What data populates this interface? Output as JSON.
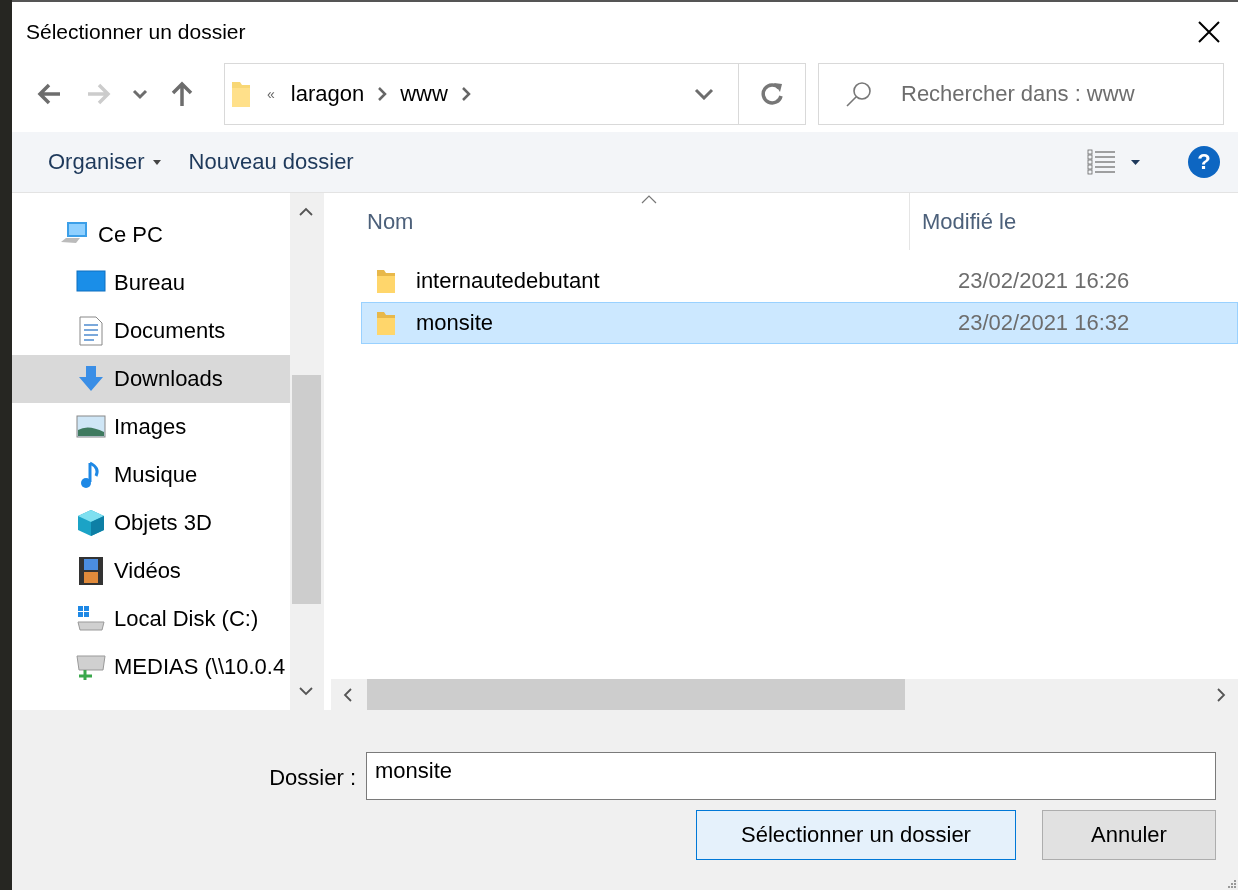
{
  "window": {
    "title": "Sélectionner un dossier"
  },
  "nav": [
    {
      "kind": "back",
      "disabled": false
    },
    {
      "kind": "forward",
      "disabled": true
    },
    {
      "kind": "recent",
      "disabled": false
    },
    {
      "kind": "up",
      "disabled": false
    }
  ],
  "address": {
    "overflow": "«",
    "segments": [
      "laragon",
      "www"
    ]
  },
  "search": {
    "placeholder": "Rechercher dans : www"
  },
  "toolbar": {
    "organize": "Organiser",
    "new_folder": "Nouveau dossier",
    "help": "?"
  },
  "sidebar": {
    "items": [
      {
        "label": "Ce PC",
        "kind": "pc",
        "selected": false,
        "children": [
          {
            "label": "Bureau",
            "kind": "desktop",
            "selected": false
          },
          {
            "label": "Documents",
            "kind": "documents",
            "selected": false
          },
          {
            "label": "Downloads",
            "kind": "downloads",
            "selected": true
          },
          {
            "label": "Images",
            "kind": "images",
            "selected": false
          },
          {
            "label": "Musique",
            "kind": "music",
            "selected": false
          },
          {
            "label": "Objets 3D",
            "kind": "objects3d",
            "selected": false
          },
          {
            "label": "Vidéos",
            "kind": "videos",
            "selected": false
          },
          {
            "label": "Local Disk (C:)",
            "kind": "disk",
            "selected": false
          },
          {
            "label": "MEDIAS (\\\\10.0.4",
            "kind": "netdrive",
            "selected": false
          }
        ]
      }
    ]
  },
  "table": {
    "columns": [
      "Nom",
      "Modifié le"
    ],
    "rows": [
      {
        "name": "internautedebutant",
        "modified": "23/02/2021 16:26",
        "selected": false
      },
      {
        "name": "monsite",
        "modified": "23/02/2021 16:32",
        "selected": true
      }
    ]
  },
  "folder_field": {
    "label": "Dossier :",
    "value": "monsite"
  },
  "buttons": [
    {
      "label": "Sélectionner un dossier",
      "kind": "primary"
    },
    {
      "label": "Annuler",
      "kind": "secondary"
    }
  ]
}
